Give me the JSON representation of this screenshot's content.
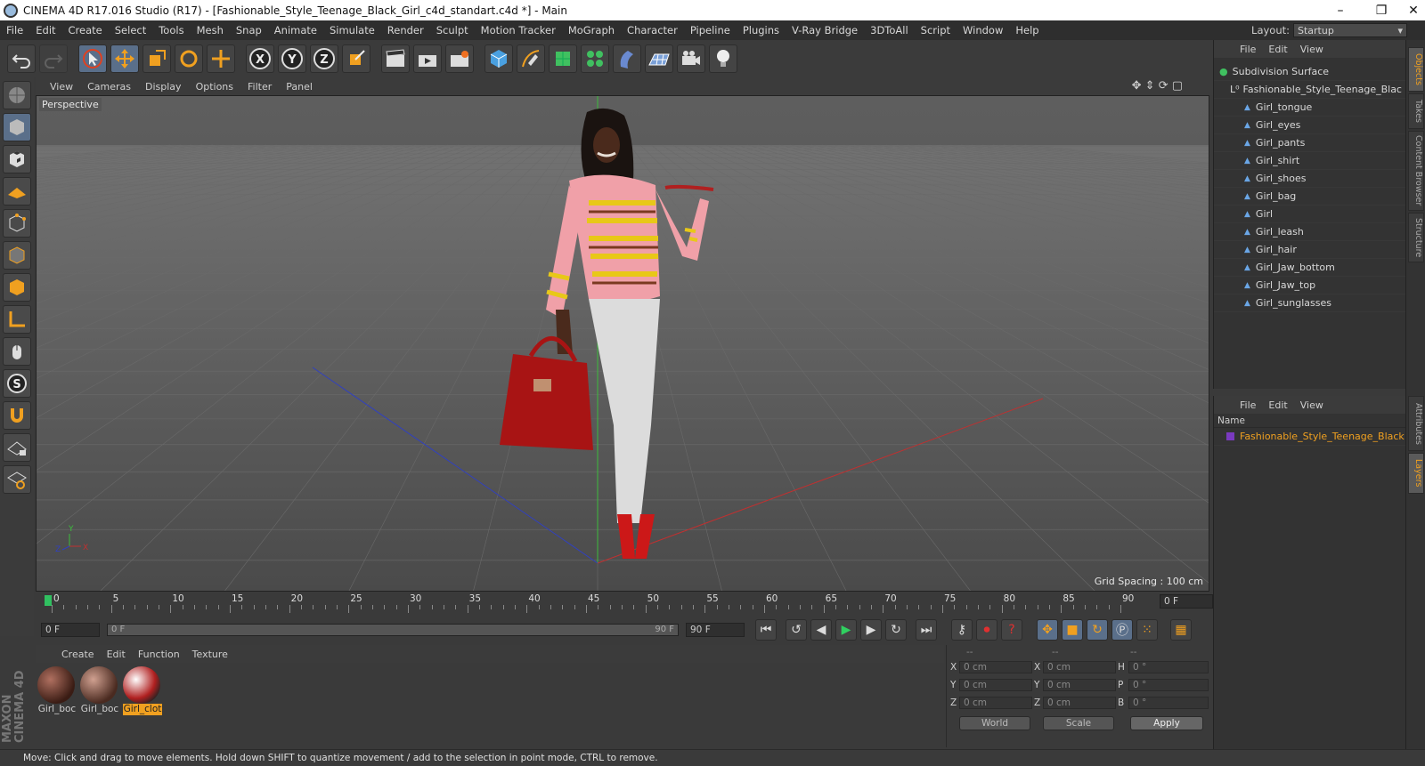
{
  "window": {
    "title": "CINEMA 4D R17.016 Studio (R17) - [Fashionable_Style_Teenage_Black_Girl_c4d_standart.c4d *] - Main",
    "minimize": "–",
    "maximize": "❐",
    "close": "✕"
  },
  "menubar": [
    "File",
    "Edit",
    "Create",
    "Select",
    "Tools",
    "Mesh",
    "Snap",
    "Animate",
    "Simulate",
    "Render",
    "Sculpt",
    "Motion Tracker",
    "MoGraph",
    "Character",
    "Pipeline",
    "Plugins",
    "V-Ray Bridge",
    "3DToAll",
    "Script",
    "Window",
    "Help"
  ],
  "layout": {
    "label": "Layout:",
    "value": "Startup"
  },
  "viewport": {
    "menu": [
      "View",
      "Cameras",
      "Display",
      "Options",
      "Filter",
      "Panel"
    ],
    "label": "Perspective",
    "grid_spacing": "Grid Spacing : 100 cm",
    "axis_y": "Y",
    "axis_x": "X",
    "axis_z": "Z"
  },
  "timeline": {
    "ticks": [
      "0",
      "5",
      "10",
      "15",
      "20",
      "25",
      "30",
      "35",
      "40",
      "45",
      "50",
      "55",
      "60",
      "65",
      "70",
      "75",
      "80",
      "85",
      "90"
    ],
    "end_field": "0 F"
  },
  "transport": {
    "current": "0 F",
    "slider_start": "0 F",
    "slider_end": "90 F",
    "end": "90 F"
  },
  "materials": {
    "menu": [
      "Create",
      "Edit",
      "Function",
      "Texture"
    ],
    "items": [
      {
        "label": "Girl_boc"
      },
      {
        "label": "Girl_boc"
      },
      {
        "label": "Girl_clot"
      }
    ]
  },
  "coords": {
    "headers": [
      "--",
      "--",
      "--"
    ],
    "rows": [
      {
        "a": "X",
        "av": "0 cm",
        "b": "X",
        "bv": "0 cm",
        "c": "H",
        "cv": "0 °"
      },
      {
        "a": "Y",
        "av": "0 cm",
        "b": "Y",
        "bv": "0 cm",
        "c": "P",
        "cv": "0 °"
      },
      {
        "a": "Z",
        "av": "0 cm",
        "b": "Z",
        "bv": "0 cm",
        "c": "B",
        "cv": "0 °"
      }
    ],
    "world": "World",
    "scale": "Scale",
    "apply": "Apply"
  },
  "status": "Move: Click and drag to move elements. Hold down SHIFT to quantize movement / add to the selection in point mode, CTRL to remove.",
  "brand": "MAXON CINEMA 4D",
  "objects": {
    "menu": [
      "File",
      "Edit",
      "View"
    ],
    "root": "Subdivision Surface",
    "group": "Fashionable_Style_Teenage_Blac",
    "children": [
      "Girl_tongue",
      "Girl_eyes",
      "Girl_pants",
      "Girl_shirt",
      "Girl_shoes",
      "Girl_bag",
      "Girl",
      "Girl_leash",
      "Girl_hair",
      "Girl_Jaw_bottom",
      "Girl_Jaw_top",
      "Girl_sunglasses"
    ]
  },
  "layers": {
    "menu": [
      "File",
      "Edit",
      "View"
    ],
    "column": "Name",
    "item": "Fashionable_Style_Teenage_Black"
  },
  "side_tabs": [
    "Objects",
    "Takes",
    "Content Browser",
    "Structure",
    "Attributes",
    "Layers"
  ]
}
